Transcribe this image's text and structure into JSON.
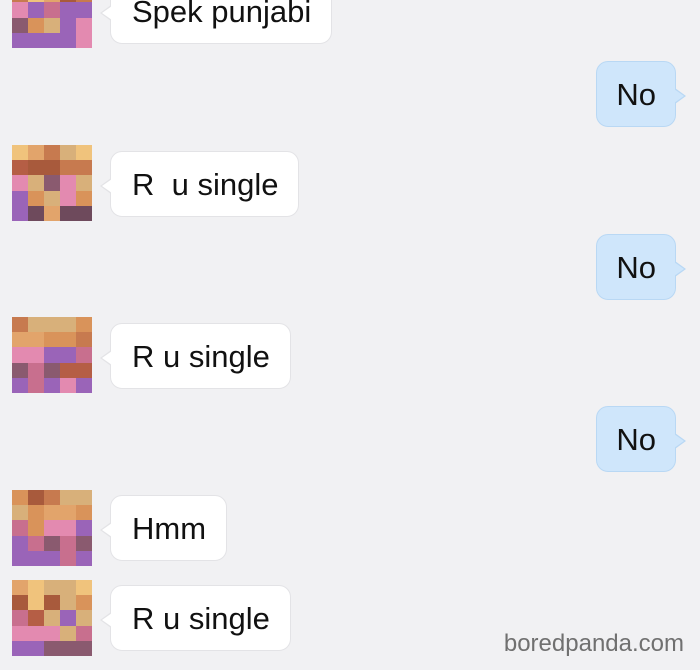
{
  "conversation": {
    "messages": [
      {
        "sender": "contact",
        "text": "Spek punjabi"
      },
      {
        "sender": "me",
        "text": "No"
      },
      {
        "sender": "contact",
        "text": "R  u single"
      },
      {
        "sender": "me",
        "text": "No"
      },
      {
        "sender": "contact",
        "text": "R u single"
      },
      {
        "sender": "me",
        "text": "No"
      },
      {
        "sender": "contact",
        "text": "Hmm"
      },
      {
        "sender": "contact",
        "text": "R u single"
      }
    ]
  },
  "watermark": {
    "text": "boredpanda.com"
  },
  "colors": {
    "background": "#f1f1f3",
    "incoming_bubble": "#ffffff",
    "outgoing_bubble": "#cfe6fb",
    "text": "#111111"
  },
  "avatar_pixel_palette": [
    "#c77a4f",
    "#d9935a",
    "#b55e45",
    "#e2a46b",
    "#8a5a6f",
    "#c86f8e",
    "#9a64b8",
    "#d8b07a",
    "#6e4a5c",
    "#e38ab0",
    "#a85a3c",
    "#f0c37c"
  ]
}
